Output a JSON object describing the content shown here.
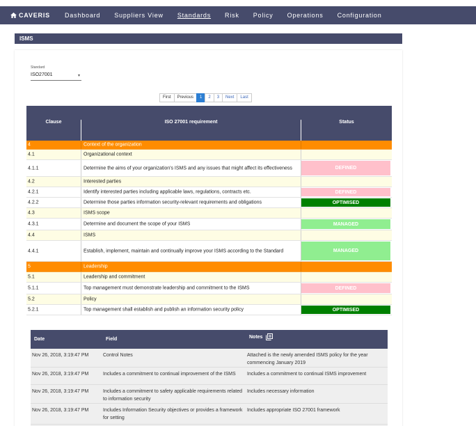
{
  "nav": {
    "brand": "CAVERIS",
    "items": [
      "Dashboard",
      "Suppliers View",
      "Standards",
      "Risk",
      "Policy",
      "Operations",
      "Configuration"
    ],
    "active": "Standards"
  },
  "section": {
    "title": "ISMS"
  },
  "standard": {
    "label": "Standard",
    "value": "ISO27001"
  },
  "pagination": {
    "first": "First",
    "previous": "Previous",
    "pages": [
      "1",
      "2",
      "3"
    ],
    "current": "1",
    "next": "Next",
    "last": "Last"
  },
  "table": {
    "headers": {
      "clause": "Clause",
      "requirement": "ISO 27001 requirement",
      "status": "Status"
    },
    "rows": [
      {
        "clause": "4",
        "text": "Context of the organization",
        "type": "section",
        "status": ""
      },
      {
        "clause": "4.1",
        "text": "Organizational context",
        "type": "sub",
        "status": ""
      },
      {
        "clause": "4.1.1",
        "text": "Determine the aims of your organization's ISMS and any issues that might affect its effectiveness",
        "type": "item",
        "status": "DEFINED"
      },
      {
        "clause": "4.2",
        "text": "Interested parties",
        "type": "sub",
        "status": ""
      },
      {
        "clause": "4.2.1",
        "text": "Identify interested parties including applicable laws, regulations, contracts etc.",
        "type": "item",
        "status": "DEFINED"
      },
      {
        "clause": "4.2.2",
        "text": "Determine those parties information security-relevant requirements and obligations",
        "type": "item",
        "status": "OPTIMISED"
      },
      {
        "clause": "4.3",
        "text": "ISMS scope",
        "type": "sub",
        "status": ""
      },
      {
        "clause": "4.3.1",
        "text": "Determine and document the scope of your ISMS",
        "type": "item",
        "status": "MANAGED"
      },
      {
        "clause": "4.4",
        "text": "ISMS",
        "type": "sub",
        "status": ""
      },
      {
        "clause": "4.4.1",
        "text": "Establish, implement, maintain and continually improve your ISMS according to the Standard",
        "type": "item",
        "status": "MANAGED"
      },
      {
        "clause": "5",
        "text": "Leadership",
        "type": "section",
        "status": ""
      },
      {
        "clause": "5.1",
        "text": "Leadership and commitment",
        "type": "sub",
        "status": ""
      },
      {
        "clause": "5.1.1",
        "text": "Top management must demonstrate leadership and commitment to the ISMS",
        "type": "item",
        "status": "DEFINED"
      },
      {
        "clause": "5.2",
        "text": "Policy",
        "type": "sub",
        "status": ""
      },
      {
        "clause": "5.2.1",
        "text": "Top management shall establish and publish an information security policy",
        "type": "item",
        "status": "OPTIMISED"
      }
    ]
  },
  "status_colors": {
    "DEFINED": "#ffc0cb",
    "OPTIMISED": "#008000",
    "MANAGED": "#90ee90"
  },
  "notes": {
    "headers": {
      "date": "Date",
      "field": "Field",
      "notes": "Notes"
    },
    "rows": [
      {
        "date": "Nov 26, 2018, 3:19:47 PM",
        "field": "Control Notes",
        "notes": "Attached is the newly amended ISMS policy for the year commencing January 2019"
      },
      {
        "date": "Nov 26, 2018, 3:19:47 PM",
        "field": "Includes a commitment to continual improvement of the ISMS",
        "notes": "Includes a commitment to continual ISMS improvement"
      },
      {
        "date": "Nov 26, 2018, 3:19:47 PM",
        "field": "Includes a commitment to safety applicable requirements related to information security",
        "notes": "Includes necessary information"
      },
      {
        "date": "Nov 26, 2018, 3:19:47 PM",
        "field": "Includes Information Security objectives or provides a framework for setting",
        "notes": "Includes appropriate ISO 27001 framework"
      }
    ]
  }
}
